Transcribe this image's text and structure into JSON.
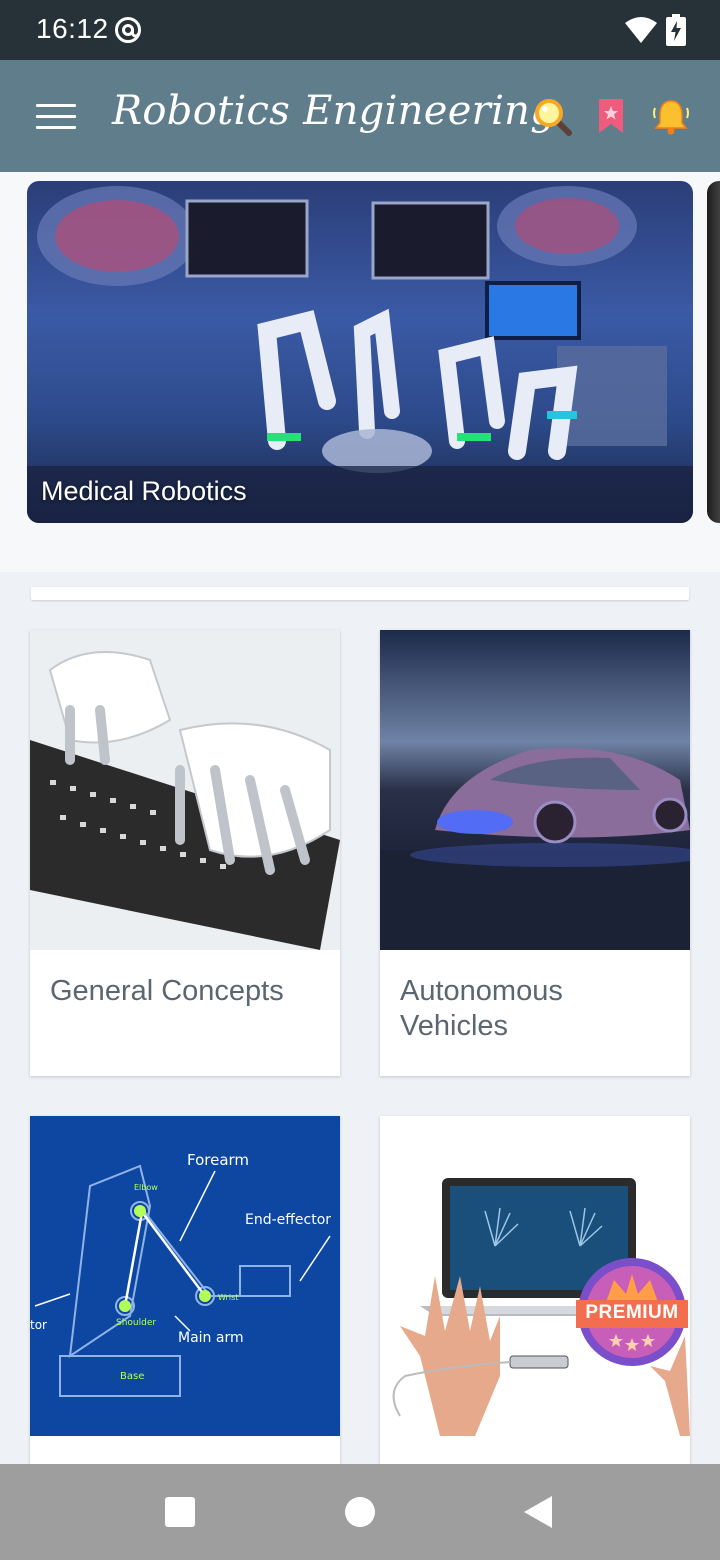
{
  "status_bar": {
    "time": "16:12",
    "icons": [
      "at-sign-icon",
      "wifi-icon",
      "battery-charging-icon"
    ]
  },
  "app_bar": {
    "title": "Robotics Engineering",
    "icons": [
      "menu-icon",
      "search-icon",
      "bookmark-icon",
      "bell-icon"
    ],
    "background_color": "#607d8b"
  },
  "carousel": {
    "slides": [
      {
        "caption": "Medical Robotics"
      }
    ]
  },
  "categories": [
    {
      "title": "General Concepts"
    },
    {
      "title": "Autonomous Vehicles"
    },
    {
      "title": "",
      "diagram_labels": [
        "Forearm",
        "End-effector",
        "Elbow",
        "Wrist",
        "Shoulder",
        "Main arm",
        "Base",
        "tor"
      ]
    },
    {
      "title": "",
      "badge": "PREMIUM"
    }
  ],
  "nav_bar": {
    "icons": [
      "recents-icon",
      "home-icon",
      "back-icon"
    ]
  }
}
